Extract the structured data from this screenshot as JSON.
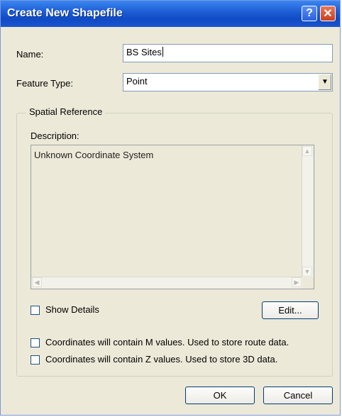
{
  "window": {
    "title": "Create New Shapefile",
    "help_glyph": "?",
    "close_glyph": "✕"
  },
  "form": {
    "name_label": "Name:",
    "name_value": "BS Sites",
    "feature_type_label": "Feature Type:",
    "feature_type_value": "Point"
  },
  "spatial_reference": {
    "legend": "Spatial Reference",
    "description_label": "Description:",
    "description_text": "Unknown Coordinate System",
    "show_details_label": "Show Details",
    "edit_button": "Edit..."
  },
  "options": {
    "m_values_label": "Coordinates will contain M values. Used to store route data.",
    "z_values_label": "Coordinates will contain Z values. Used to store 3D data."
  },
  "buttons": {
    "ok": "OK",
    "cancel": "Cancel"
  },
  "icons": {
    "dropdown": "chevron-down-icon",
    "scroll_up": "arrow-up-icon",
    "scroll_down": "arrow-down-icon",
    "scroll_left": "arrow-left-icon",
    "scroll_right": "arrow-right-icon"
  }
}
